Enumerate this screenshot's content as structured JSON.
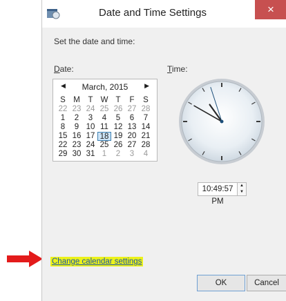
{
  "window": {
    "title": "Date and Time Settings",
    "close_glyph": "×",
    "instruction": "Set the date and time:",
    "date_label_u": "D",
    "date_label_rest": "ate:",
    "time_label_u": "T",
    "time_label_rest": "ime:"
  },
  "calendar": {
    "month_title": "March, 2015",
    "prev_glyph": "◀",
    "next_glyph": "▶",
    "weekdays": [
      "S",
      "M",
      "T",
      "W",
      "T",
      "F",
      "S"
    ],
    "weeks": [
      [
        [
          "22",
          "o"
        ],
        [
          "23",
          "o"
        ],
        [
          "24",
          "o"
        ],
        [
          "25",
          "o"
        ],
        [
          "26",
          "o"
        ],
        [
          "27",
          "o"
        ],
        [
          "28",
          "o"
        ]
      ],
      [
        [
          "1",
          "c"
        ],
        [
          "2",
          "c"
        ],
        [
          "3",
          "c"
        ],
        [
          "4",
          "c"
        ],
        [
          "5",
          "c"
        ],
        [
          "6",
          "c"
        ],
        [
          "7",
          "c"
        ]
      ],
      [
        [
          "8",
          "c"
        ],
        [
          "9",
          "c"
        ],
        [
          "10",
          "c"
        ],
        [
          "11",
          "c"
        ],
        [
          "12",
          "c"
        ],
        [
          "13",
          "c"
        ],
        [
          "14",
          "c"
        ]
      ],
      [
        [
          "15",
          "c"
        ],
        [
          "16",
          "c"
        ],
        [
          "17",
          "c"
        ],
        [
          "18",
          "s"
        ],
        [
          "19",
          "c"
        ],
        [
          "20",
          "c"
        ],
        [
          "21",
          "c"
        ]
      ],
      [
        [
          "22",
          "c"
        ],
        [
          "23",
          "c"
        ],
        [
          "24",
          "c"
        ],
        [
          "25",
          "c"
        ],
        [
          "26",
          "c"
        ],
        [
          "27",
          "c"
        ],
        [
          "28",
          "c"
        ]
      ],
      [
        [
          "29",
          "c"
        ],
        [
          "30",
          "c"
        ],
        [
          "31",
          "c"
        ],
        [
          "1",
          "o"
        ],
        [
          "2",
          "o"
        ],
        [
          "3",
          "o"
        ],
        [
          "4",
          "o"
        ]
      ]
    ]
  },
  "time": {
    "value": "10:49:57 PM",
    "hour": 22,
    "minute": 49,
    "second": 57,
    "spinner_up": "▲",
    "spinner_down": "▼"
  },
  "links": {
    "change_calendar": "Change calendar settings"
  },
  "buttons": {
    "ok": "OK",
    "cancel": "Cancel"
  },
  "colors": {
    "highlight": "#ecf21a",
    "link": "#1a55a8",
    "annotation_arrow": "#e31b1b",
    "close_button": "#c75050",
    "selected_day": "#cde4f7"
  },
  "icons": {
    "app": "calendar-clock-icon",
    "close": "close-icon",
    "annotation": "arrow-right-icon"
  }
}
